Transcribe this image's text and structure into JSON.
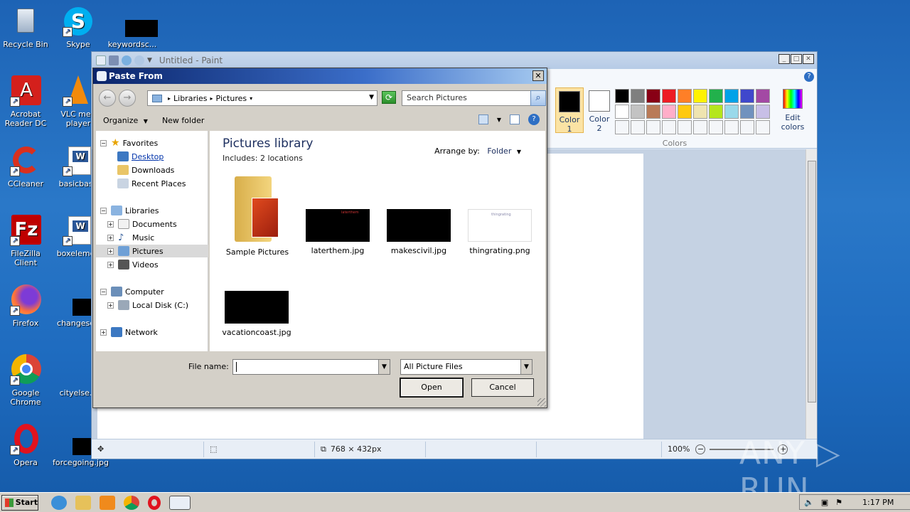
{
  "desktop": {
    "icons": [
      {
        "label": "Recycle Bin",
        "name": "recycle-bin"
      },
      {
        "label": "Skype",
        "name": "skype"
      },
      {
        "label": "keywordsc...",
        "name": "keywordsc"
      },
      {
        "label": "Acrobat Reader DC",
        "name": "acrobat"
      },
      {
        "label": "VLC med player",
        "name": "vlc"
      },
      {
        "label": "CCleaner",
        "name": "ccleaner"
      },
      {
        "label": "basicbase",
        "name": "basicbase"
      },
      {
        "label": "FileZilla Client",
        "name": "filezilla"
      },
      {
        "label": "boxelemen",
        "name": "boxelemen"
      },
      {
        "label": "Firefox",
        "name": "firefox"
      },
      {
        "label": "changesde",
        "name": "changesde"
      },
      {
        "label": "Google Chrome",
        "name": "chrome"
      },
      {
        "label": "cityelse.p",
        "name": "cityelse"
      },
      {
        "label": "Opera",
        "name": "opera"
      },
      {
        "label": "forcegoing.jpg",
        "name": "forcegoing"
      }
    ]
  },
  "paint": {
    "title": "Untitled - Paint",
    "color1_label_1": "Color",
    "color1_label_2": "1",
    "color2_label_1": "Color",
    "color2_label_2": "2",
    "edit_colors_1": "Edit",
    "edit_colors_2": "colors",
    "colors_group": "Colors",
    "palette_row1": [
      "#000000",
      "#7f7f7f",
      "#880015",
      "#ed1c24",
      "#ff7f27",
      "#fff200",
      "#22b14c",
      "#00a2e8",
      "#3f48cc",
      "#a349a4"
    ],
    "palette_row2": [
      "#ffffff",
      "#c3c3c3",
      "#b97a57",
      "#ffaec9",
      "#ffc90e",
      "#efe4b0",
      "#b5e61d",
      "#99d9ea",
      "#7092be",
      "#c8bfe7"
    ],
    "status_size": "768 × 432px",
    "zoom": "100%"
  },
  "dialog": {
    "title": "Paste From",
    "breadcrumb_1": "Libraries",
    "breadcrumb_2": "Pictures",
    "search_placeholder": "Search Pictures",
    "organize": "Organize",
    "new_folder": "New folder",
    "nav": {
      "favorites": "Favorites",
      "desktop": "Desktop",
      "downloads": "Downloads",
      "recent": "Recent Places",
      "libraries": "Libraries",
      "documents": "Documents",
      "music": "Music",
      "pictures": "Pictures",
      "videos": "Videos",
      "computer": "Computer",
      "local_disk": "Local Disk (C:)",
      "network": "Network"
    },
    "library_title": "Pictures library",
    "library_sub": "Includes:  2 locations",
    "arrange_by_label": "Arrange by:",
    "arrange_by_value": "Folder",
    "files": [
      {
        "name": "Sample Pictures"
      },
      {
        "name": "laterthem.jpg",
        "thumb_text": "laterthem"
      },
      {
        "name": "makescivil.jpg"
      },
      {
        "name": "thingrating.png",
        "thumb_text": "thingrating"
      },
      {
        "name": "vacationcoast.jpg"
      }
    ],
    "file_name_label": "File name:",
    "file_name_value": "",
    "filter_value": "All Picture Files",
    "open": "Open",
    "cancel": "Cancel"
  },
  "taskbar": {
    "start": "Start",
    "clock": "1:17 PM"
  },
  "watermark": "ANY ▷ RUN"
}
